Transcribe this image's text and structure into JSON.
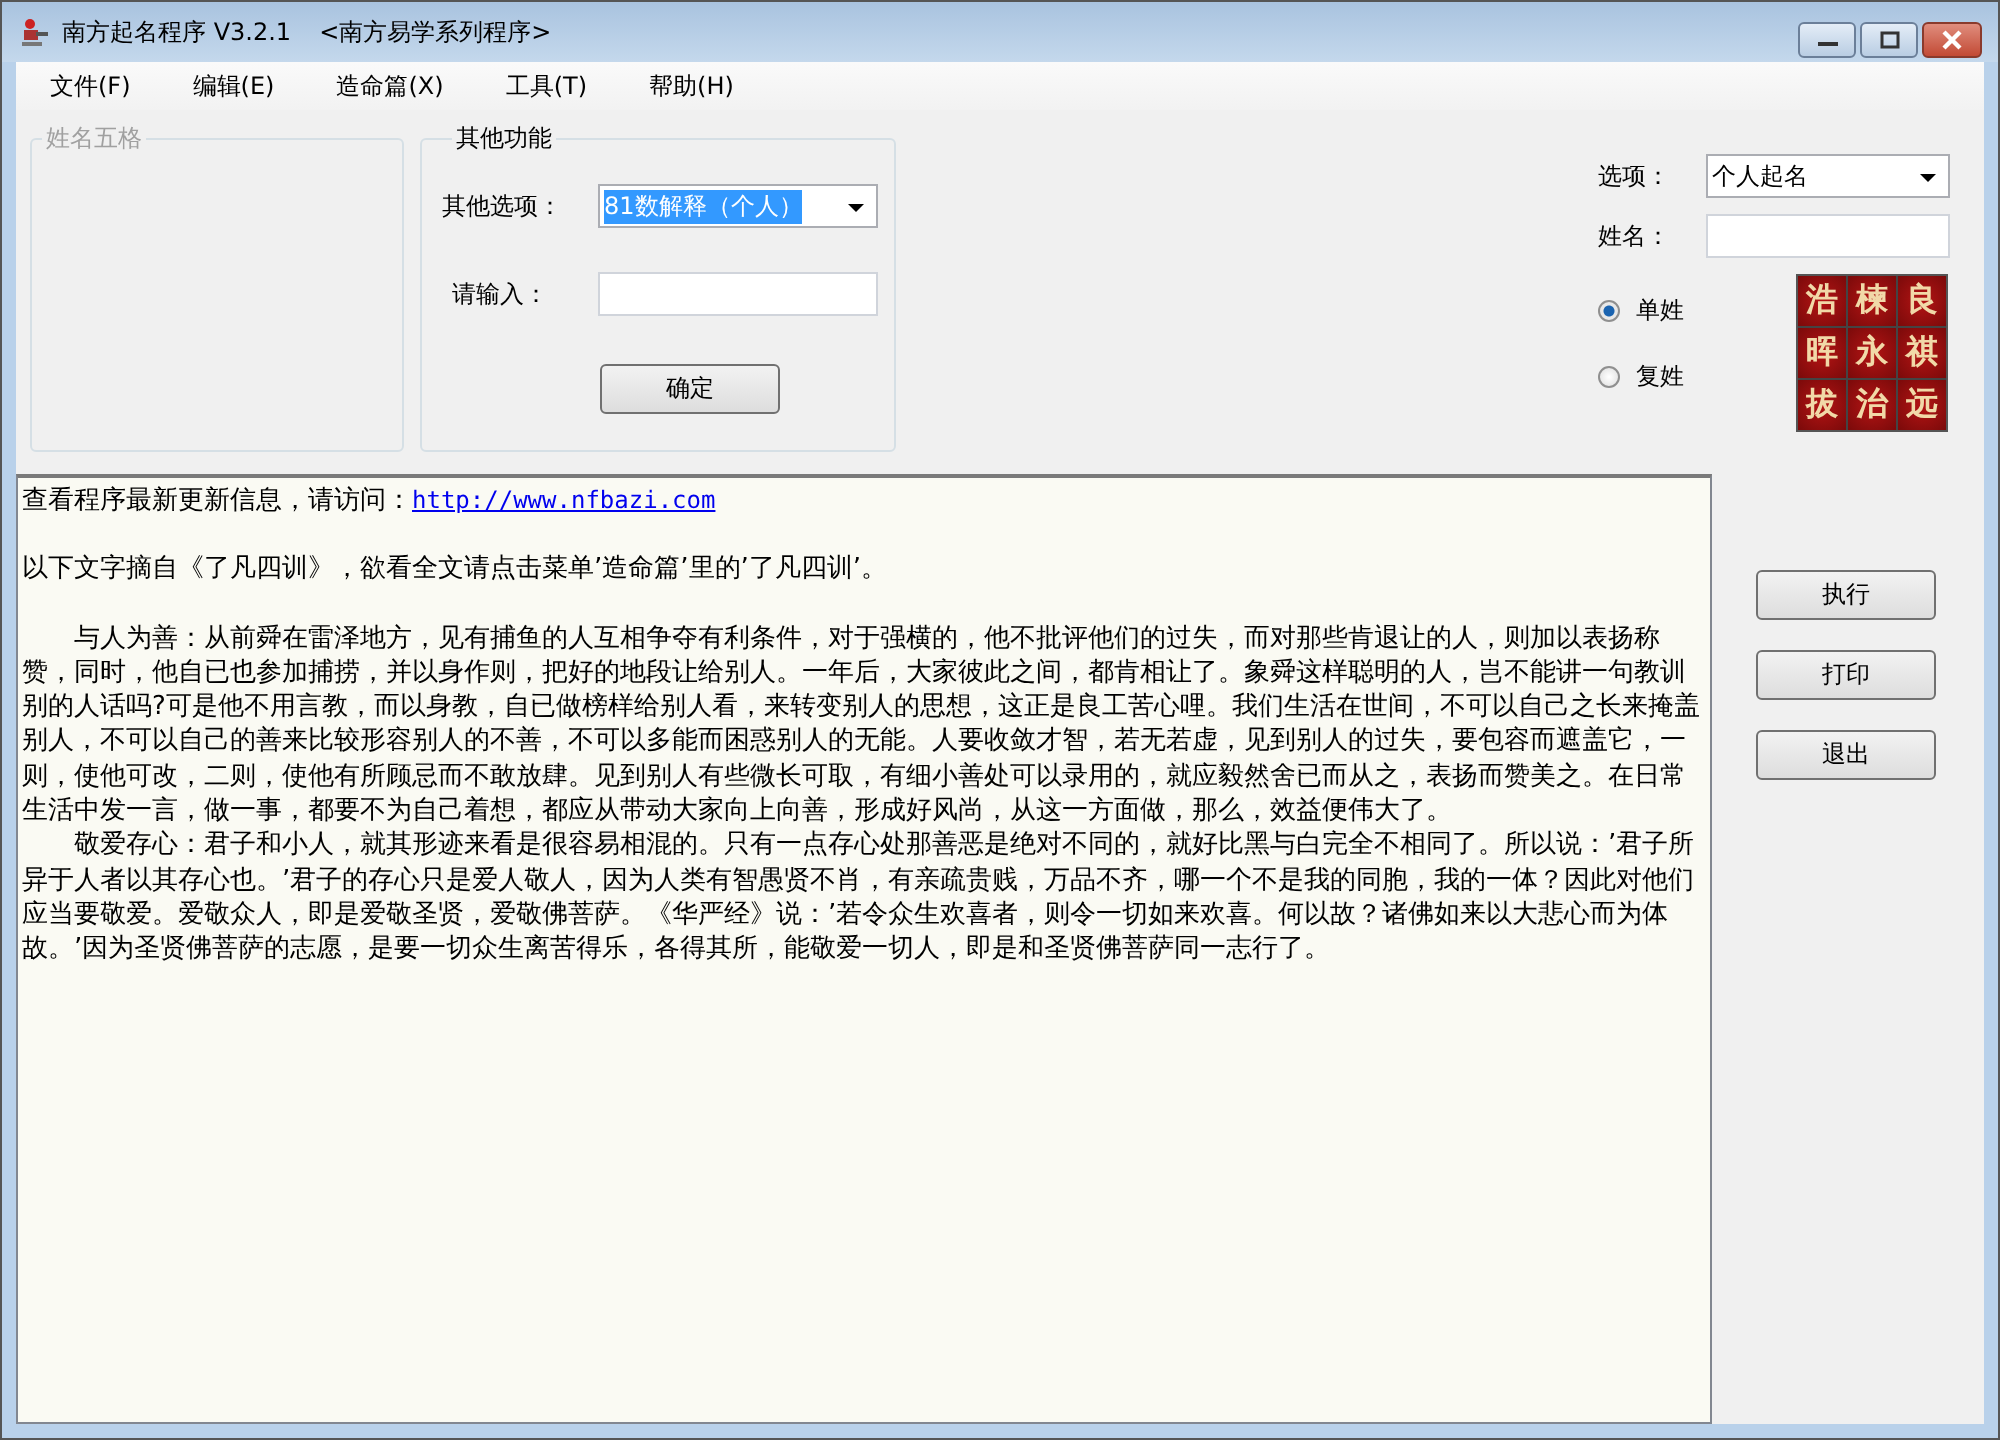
{
  "window": {
    "title": "南方起名程序 V3.2.1",
    "subtitle": "<南方易学系列程序>"
  },
  "menu": [
    "文件(F)",
    "编辑(E)",
    "造命篇(X)",
    "工具(T)",
    "帮助(H)"
  ],
  "name_group": {
    "title": "姓名五格",
    "disabled": true
  },
  "other_group": {
    "title": "其他功能",
    "option_label": "其他选项：",
    "option_value": "81数解释（个人）",
    "option_highlighted": true,
    "input_label": "请输入：",
    "confirm": "确定"
  },
  "right_form": {
    "option_label": "选项：",
    "option_value": "个人起名",
    "name_label": "姓名：",
    "radios": [
      {
        "label": "单姓",
        "selected": true
      },
      {
        "label": "复姓",
        "selected": false
      }
    ],
    "tiles": [
      "浩",
      "楝",
      "良",
      "晖",
      "永",
      "祺",
      "拔",
      "治",
      "远"
    ]
  },
  "text_area": {
    "intro": "查看程序最新更新信息，请访问：",
    "link": "http://www.nfbazi.com",
    "source": "以下文字摘自《了凡四训》，欲看全文请点击菜单’造命篇’里的’了凡四训’。",
    "paragraphs": [
      "与人为善：从前舜在雷泽地方，见有捕鱼的人互相争夺有利条件，对于强横的，他不批评他们的过失，而对那些肯退让的人，则加以表扬称赞，同时，他自已也参加捕捞，并以身作则，把好的地段让给别人。一年后，大家彼此之间，都肯相让了。象舜这样聪明的人，岂不能讲一句教训别的人话吗?可是他不用言教，而以身教，自已做榜样给别人看，来转变别人的思想，这正是良工苦心哩。我们生活在世间，不可以自己之长来掩盖别人，不可以自己的善来比较形容别人的不善，不可以多能而困惑别人的无能。人要收敛才智，若无若虚，见到别人的过失，要包容而遮盖它，一则，使他可改，二则，使他有所顾忌而不敢放肆。见到别人有些微长可取，有细小善处可以录用的，就应毅然舍已而从之，表扬而赞美之。在日常生活中发一言，做一事，都要不为自己着想，都应从带动大家向上向善，形成好风尚，从这一方面做，那么，效益便伟大了。",
      "敬爱存心：君子和小人，就其形迹来看是很容易相混的。只有一点存心处那善恶是绝对不同的，就好比黑与白完全不相同了。所以说：’君子所异于人者以其存心也。’君子的存心只是爱人敬人，因为人类有智愚贤不肖，有亲疏贵贱，万品不齐，哪一个不是我的同胞，我的一体？因此对他们应当要敬爱。爱敬众人，即是爱敬圣贤，爱敬佛菩萨。《华严经》说：’若令众生欢喜者，则令一切如来欢喜。何以故？诸佛如来以大悲心而为体故。’因为圣贤佛菩萨的志愿，是要一切众生离苦得乐，各得其所，能敬爱一切人，即是和圣贤佛菩萨同一志行了。"
    ]
  },
  "buttons": [
    "执行",
    "打印",
    "退出"
  ]
}
